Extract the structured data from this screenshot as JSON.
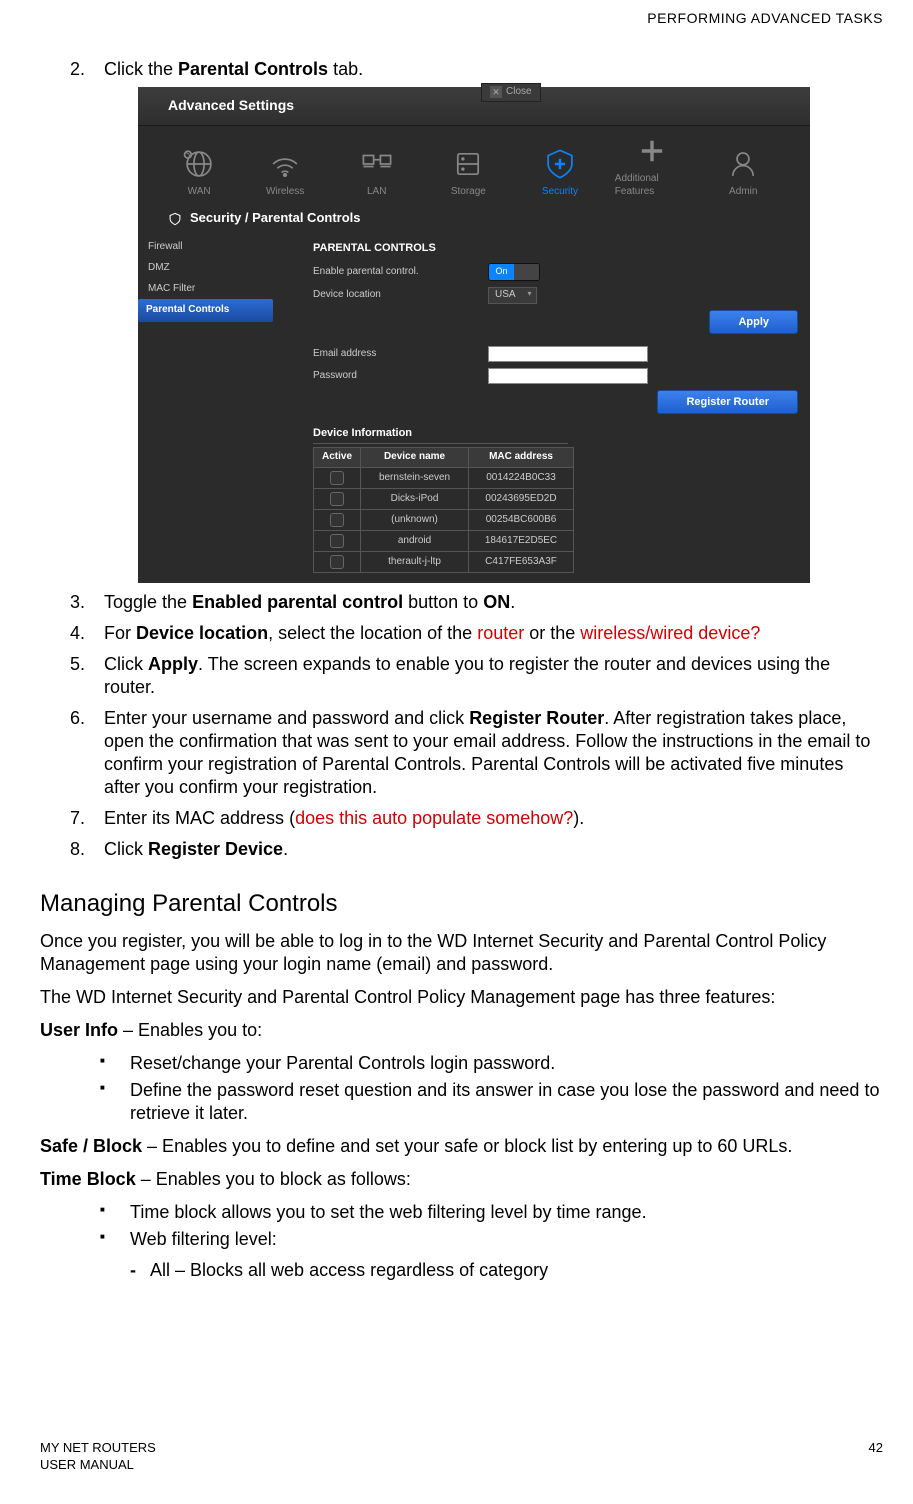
{
  "header": "PERFORMING ADVANCED TASKS",
  "steps": {
    "s2_a": "Click the ",
    "s2_b": "Parental Controls",
    "s2_c": " tab.",
    "s3_a": "Toggle the ",
    "s3_b": "Enabled parental control",
    "s3_c": " button to ",
    "s3_d": "ON",
    "s3_e": ".",
    "s4_a": "For ",
    "s4_b": "Device location",
    "s4_c": ", select the location of the ",
    "s4_d": "router",
    "s4_e": " or the ",
    "s4_f": "wireless/wired device?",
    "s5_a": "Click ",
    "s5_b": "Apply",
    "s5_c": ". The screen expands to enable you to register the router and devices using the router.",
    "s6_a": "Enter your username and password and click ",
    "s6_b": "Register Router",
    "s6_c": ". After registration takes place, open the confirmation that was sent to your email address. Follow the instructions in the email to confirm your registration of Parental Controls. Parental Controls will be activated five minutes after you confirm your registration.",
    "s7_a": "Enter its MAC address (",
    "s7_b": "does this auto populate somehow?",
    "s7_c": ").",
    "s8_a": "Click ",
    "s8_b": "Register Device",
    "s8_c": "."
  },
  "h2": "Managing Parental Controls",
  "p1": "Once you register, you will be able to log in to the WD Internet Security and Parental Control Policy Management page using your login name (email) and password.",
  "p2": "The WD Internet Security and Parental Control Policy Management page has three features:",
  "userinfo_a": "User Info",
  "userinfo_b": " – Enables you to:",
  "ui_bullet1": "Reset/change your Parental Controls login password.",
  "ui_bullet2": "Define the password reset question and its answer in case you lose the password and need to retrieve it later.",
  "safe_a": "Safe / Block",
  "safe_b": " – Enables you to define and set your safe or block list by entering up to 60 URLs.",
  "time_a": "Time Block",
  "time_b": " – Enables you to block as follows:",
  "tb_bullet1": "Time block allows you to set the web filtering level by time range.",
  "tb_bullet2": "Web filtering level:",
  "sub1": "All – Blocks all web access regardless of category",
  "footer_l1": "MY NET ROUTERS",
  "footer_l2": "USER MANUAL",
  "footer_r": "42",
  "shot": {
    "close": "Close",
    "titlebar": "Advanced Settings",
    "tabs": [
      "WAN",
      "Wireless",
      "LAN",
      "Storage",
      "Security",
      "Additional Features",
      "Admin"
    ],
    "crumb": "Security / Parental Controls",
    "sidenav": [
      "Firewall",
      "DMZ",
      "MAC Filter",
      "Parental Controls"
    ],
    "section1": "PARENTAL CONTROLS",
    "row1_label": "Enable parental control.",
    "row1_toggle": "On",
    "row2_label": "Device location",
    "row2_value": "USA",
    "apply": "Apply",
    "row3_label": "Email address",
    "row4_label": "Password",
    "register": "Register Router",
    "devinfo": "Device Information",
    "thead": [
      "Active",
      "Device name",
      "MAC address"
    ],
    "rows": [
      {
        "dev": "bernstein-seven",
        "mac": "0014224B0C33"
      },
      {
        "dev": "Dicks-iPod",
        "mac": "00243695ED2D"
      },
      {
        "dev": "(unknown)",
        "mac": "00254BC600B6"
      },
      {
        "dev": "android",
        "mac": "184617E2D5EC"
      },
      {
        "dev": "therault-j-ltp",
        "mac": "C417FE653A3F"
      }
    ]
  }
}
